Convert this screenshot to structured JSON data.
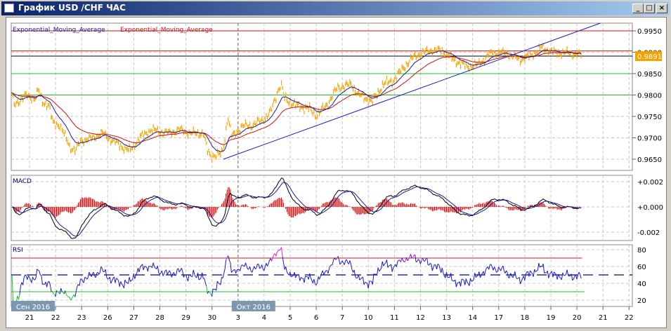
{
  "window": {
    "title": "График USD /CHF  ЧАС",
    "buttons": {
      "minimize": "_",
      "maximize": "□",
      "close": "×"
    }
  },
  "chart_data": [
    {
      "type": "line",
      "title": "USD/CHF H1",
      "legend": [
        "Exponential_Moving_Average",
        "Exponential_Moving_Average"
      ],
      "legend_colors": [
        "#1a1a9a",
        "#d01010"
      ],
      "ylim": [
        0.963,
        0.9975
      ],
      "yticks": [
        "0.9950",
        "0.9900",
        "0.9850",
        "0.9800",
        "0.9750",
        "0.9700",
        "0.9650"
      ],
      "ytick_values": [
        0.995,
        0.99,
        0.985,
        0.98,
        0.975,
        0.97,
        0.965
      ],
      "current_price": "0.9891",
      "current_price_value": 0.9891,
      "price_color": "#f5a300",
      "levels": [
        {
          "value": 0.995,
          "color": "#d01010"
        },
        {
          "value": 0.9903,
          "color": "#d01010"
        },
        {
          "value": 0.9891,
          "color": "#000000"
        },
        {
          "value": 0.985,
          "color": "#20c020"
        },
        {
          "value": 0.98,
          "color": "#20c020"
        }
      ],
      "trendline": {
        "from": [
          7.44,
          0.965
        ],
        "to": [
          21.9,
          0.9968
        ],
        "color": "#1a1acc"
      },
      "series_price_waypoints_day_price": [
        [
          -0.67,
          0.9801
        ],
        [
          -0.59,
          0.9776
        ],
        [
          -0.19,
          0.9798
        ],
        [
          0.22,
          0.9793
        ],
        [
          0.35,
          0.9812
        ],
        [
          0.49,
          0.9784
        ],
        [
          0.75,
          0.9776
        ],
        [
          0.89,
          0.9735
        ],
        [
          1.16,
          0.973
        ],
        [
          1.56,
          0.9678
        ],
        [
          1.78,
          0.967
        ],
        [
          1.97,
          0.9694
        ],
        [
          2.37,
          0.9698
        ],
        [
          2.78,
          0.9711
        ],
        [
          3.18,
          0.9694
        ],
        [
          3.58,
          0.9678
        ],
        [
          3.85,
          0.967
        ],
        [
          4.26,
          0.9702
        ],
        [
          4.66,
          0.9719
        ],
        [
          5.34,
          0.9711
        ],
        [
          5.74,
          0.9719
        ],
        [
          6.15,
          0.9711
        ],
        [
          6.68,
          0.9711
        ],
        [
          6.82,
          0.967
        ],
        [
          6.95,
          0.9658
        ],
        [
          7.36,
          0.9661
        ],
        [
          7.49,
          0.9694
        ],
        [
          7.6,
          0.9752
        ],
        [
          7.76,
          0.9702
        ],
        [
          8.17,
          0.9727
        ],
        [
          8.57,
          0.973
        ],
        [
          8.98,
          0.9743
        ],
        [
          9.25,
          0.976
        ],
        [
          9.52,
          0.9809
        ],
        [
          9.65,
          0.9825
        ],
        [
          9.78,
          0.9793
        ],
        [
          10.19,
          0.9776
        ],
        [
          10.73,
          0.9768
        ],
        [
          11.0,
          0.9752
        ],
        [
          11.4,
          0.9776
        ],
        [
          11.81,
          0.9817
        ],
        [
          12.35,
          0.9825
        ],
        [
          12.62,
          0.9801
        ],
        [
          13.15,
          0.9784
        ],
        [
          13.56,
          0.9825
        ],
        [
          13.96,
          0.9834
        ],
        [
          14.37,
          0.9866
        ],
        [
          14.77,
          0.9891
        ],
        [
          15.31,
          0.9904
        ],
        [
          15.85,
          0.9904
        ],
        [
          16.25,
          0.9883
        ],
        [
          16.79,
          0.9866
        ],
        [
          17.2,
          0.9871
        ],
        [
          17.74,
          0.9899
        ],
        [
          18.27,
          0.9899
        ],
        [
          18.81,
          0.9883
        ],
        [
          19.22,
          0.9891
        ],
        [
          19.62,
          0.9911
        ],
        [
          20.16,
          0.9899
        ],
        [
          20.7,
          0.9899
        ],
        [
          21.19,
          0.9894
        ]
      ],
      "ema_periods": [
        14,
        40
      ]
    },
    {
      "type": "bar",
      "title": "MACD",
      "yticks": [
        "+0.002",
        "+0.000",
        "-0.002"
      ],
      "ytick_values": [
        0.002,
        0,
        -0.002
      ],
      "ylim": [
        -0.0025,
        0.0024
      ],
      "colors": {
        "macd": "#000000",
        "signal": "#1a1a9a",
        "histogram": "#d01010"
      }
    },
    {
      "type": "line",
      "title": "RSI",
      "yticks": [
        "80",
        "60",
        "40",
        "20"
      ],
      "ytick_values": [
        80,
        60,
        40,
        20
      ],
      "ylim": [
        14,
        86
      ],
      "levels": {
        "overbought": 70,
        "middle": 50,
        "oversold": 30
      },
      "colors": {
        "line": "#1a1acc",
        "overbought": "#e020e0",
        "oversold": "#20c020"
      }
    }
  ],
  "xaxis": {
    "tick_labels": [
      "21",
      "22",
      "23",
      "26",
      "27",
      "28",
      "29",
      "30",
      "3",
      "4",
      "5",
      "6",
      "7",
      "10",
      "11",
      "12",
      "13",
      "14",
      "17",
      "18",
      "19",
      "20",
      "21",
      "22"
    ],
    "month_labels": [
      {
        "label": "Сен 2016",
        "at": 0
      },
      {
        "label": "Окт 2016",
        "at": 8
      }
    ]
  }
}
